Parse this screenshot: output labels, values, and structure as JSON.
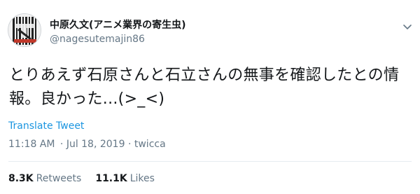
{
  "tweet": {
    "display_name": "中原久文(アニメ業界の寄生虫)",
    "handle": "@nagesutemajin86",
    "text_line1": "とりあえず石原さんと石立さんの無事を確認したとの情",
    "text_line2": "報。良かった...(>_<)",
    "translate_label": "Translate Tweet",
    "time": "11:18 AM",
    "separator": "·",
    "date": "Jul 18, 2019",
    "source": "twicca"
  },
  "stats": {
    "retweets_count": "8.3K",
    "retweets_label": "Retweets",
    "likes_count": "11.1K",
    "likes_label": "Likes"
  },
  "icons": {
    "caret": "chevron-down-icon",
    "avatar": "profile-avatar"
  },
  "colors": {
    "link": "#1b95e0",
    "secondary_text": "#657786",
    "primary_text": "#14171a",
    "divider": "#e6ecf0"
  }
}
